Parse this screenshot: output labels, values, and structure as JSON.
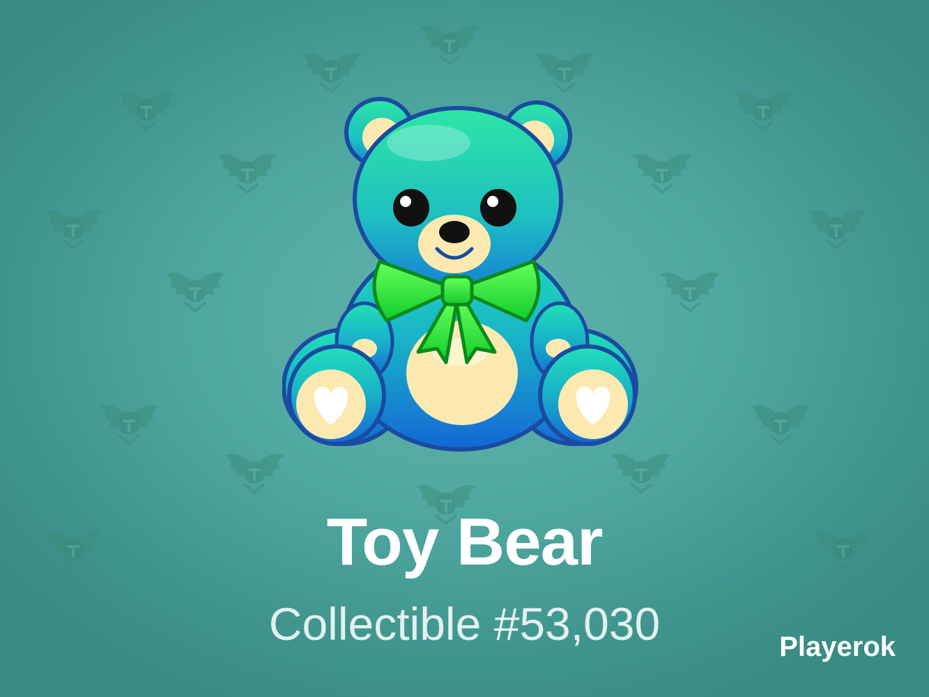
{
  "gift": {
    "name": "Toy Bear",
    "label": "Collectible #53,030"
  },
  "watermark": {
    "text": "Playerok"
  },
  "colors": {
    "background": "#4fa8a0",
    "bear_body": "#1fb8b0",
    "bear_outline": "#1c4fa3",
    "bow": "#2ee63a",
    "belly": "#fbe9b0"
  },
  "icons": {
    "pattern": "winged-helmet-emblem"
  }
}
